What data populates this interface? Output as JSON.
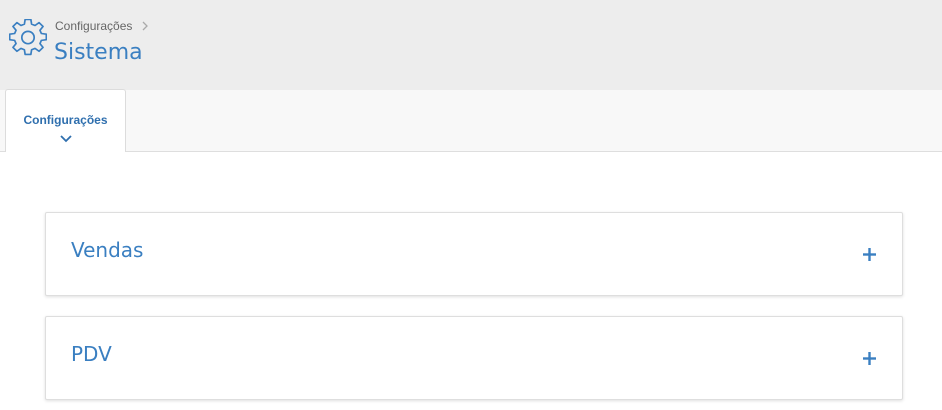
{
  "header": {
    "breadcrumb": "Configurações",
    "title": "Sistema",
    "icon": "gear-icon"
  },
  "tabs": [
    {
      "label": "Configurações",
      "active": true,
      "icon": "chevron-down-icon"
    }
  ],
  "panels": [
    {
      "title": "Vendas",
      "icon": "plus-icon",
      "expanded": false
    },
    {
      "title": "PDV",
      "icon": "plus-icon",
      "expanded": false
    }
  ],
  "colors": {
    "accent": "#3a7fc1",
    "header_bg": "#ededed",
    "tabbar_bg": "#f8f8f8",
    "border": "#dedede"
  }
}
